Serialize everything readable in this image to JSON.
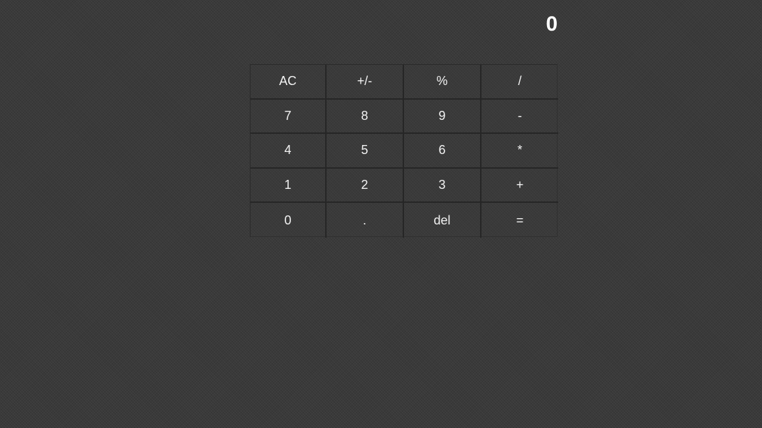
{
  "display": {
    "value": "0"
  },
  "keypad": {
    "rows": [
      [
        "AC",
        "+/-",
        "%",
        "/"
      ],
      [
        "7",
        "8",
        "9",
        "-"
      ],
      [
        "4",
        "5",
        "6",
        "*"
      ],
      [
        "1",
        "2",
        "3",
        "+"
      ],
      [
        "0",
        ".",
        "del",
        "="
      ]
    ]
  }
}
